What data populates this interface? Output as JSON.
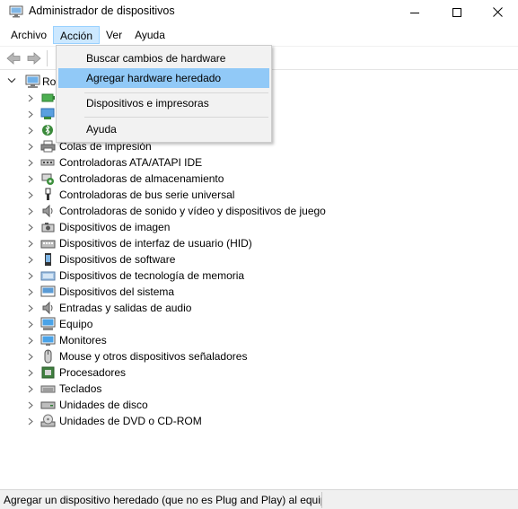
{
  "window": {
    "title": "Administrador de dispositivos"
  },
  "menu": {
    "items": [
      "Archivo",
      "Acción",
      "Ver",
      "Ayuda"
    ],
    "active": "Acción"
  },
  "action_menu": {
    "items": [
      "Buscar cambios de hardware",
      "Agregar hardware heredado",
      "Dispositivos e impresoras",
      "Ayuda"
    ],
    "highlighted": "Agregar hardware heredado"
  },
  "tree": {
    "root_label": "Ro",
    "categories": [
      "",
      "",
      "",
      "Colas de impresión",
      "Controladoras ATA/ATAPI IDE",
      "Controladoras de almacenamiento",
      "Controladoras de bus serie universal",
      "Controladoras de sonido y vídeo y dispositivos de juego",
      "Dispositivos de imagen",
      "Dispositivos de interfaz de usuario (HID)",
      "Dispositivos de software",
      "Dispositivos de tecnología de memoria",
      "Dispositivos del sistema",
      "Entradas y salidas de audio",
      "Equipo",
      "Monitores",
      "Mouse y otros dispositivos señaladores",
      "Procesadores",
      "Teclados",
      "Unidades de disco",
      "Unidades de DVD o CD-ROM"
    ]
  },
  "status": {
    "text": "Agregar un dispositivo heredado (que no es Plug and Play) al equip"
  },
  "colors": {
    "menu_active_bg": "#cce8ff",
    "dropdown_highlight": "#91c9f7",
    "dropdown_bg": "#f2f2f2"
  }
}
